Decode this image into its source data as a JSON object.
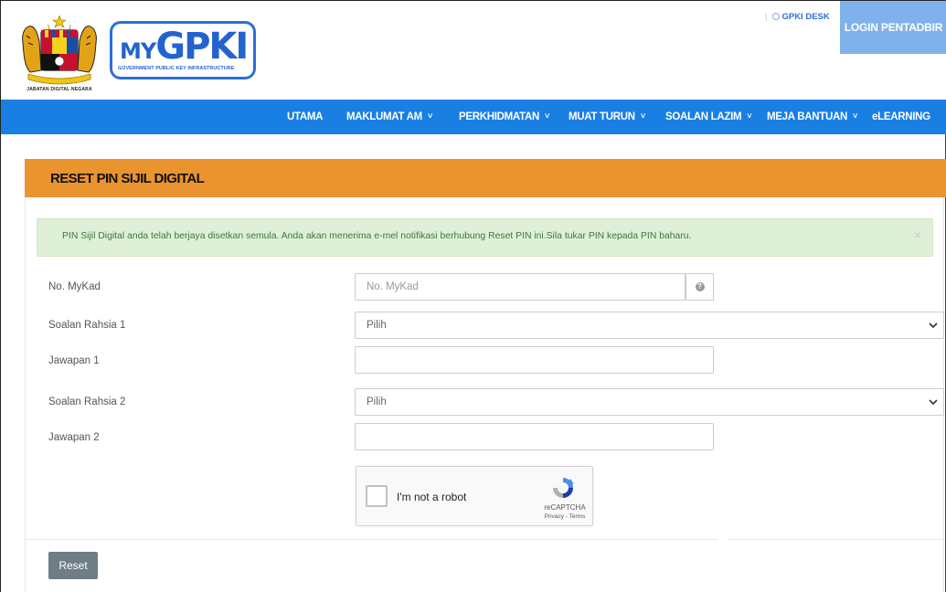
{
  "header": {
    "crest_caption": "JABATAN DIGITAL NEGARA",
    "brand_mark_prefix": "MY",
    "brand_mark": "GPKI",
    "brand_tagline": "GOVERNMENT PUBLIC KEY INFRASTRUCTURE",
    "desk_link": "GPKI DESK",
    "login_button": "LOGIN PENTADBIR"
  },
  "nav": {
    "items": [
      {
        "label": "UTAMA",
        "dropdown": false
      },
      {
        "label": "MAKLUMAT AM",
        "dropdown": true
      },
      {
        "label": "PERKHIDMATAN",
        "dropdown": true
      },
      {
        "label": "MUAT TURUN",
        "dropdown": true
      },
      {
        "label": "SOALAN LAZIM",
        "dropdown": true
      },
      {
        "label": "MEJA BANTUAN",
        "dropdown": true
      },
      {
        "label": "eLEARNING",
        "dropdown": false
      }
    ],
    "chevron": "˅"
  },
  "form": {
    "title": "RESET PIN SIJIL DIGITAL",
    "alert_message": "PIN Sijil Digital anda telah berjaya disetkan semula. Anda akan menerima e-mel notifikasi berhubung Reset PIN ini.Sila tukar PIN kepada PIN baharu.",
    "alert_close": "×",
    "mykad_label": "No. MyKad",
    "mykad_placeholder": "No. MyKad",
    "question1_label": "Soalan Rahsia 1",
    "question1_value": "Pilih",
    "answer1_label": "Jawapan 1",
    "question2_label": "Soalan Rahsia 2",
    "question2_value": "Pilih",
    "answer2_label": "Jawapan 2",
    "captcha_label": "I'm not a robot",
    "captcha_brand": "reCAPTCHA",
    "captcha_terms": "Privacy - Terms",
    "reset_button": "Reset"
  },
  "colors": {
    "nav_blue": "#1a7fe3",
    "header_orange": "#ea9430",
    "login_blue": "#7fb2ec",
    "alert_green_bg": "#dff0d8",
    "reset_gray": "#6f7e86"
  }
}
